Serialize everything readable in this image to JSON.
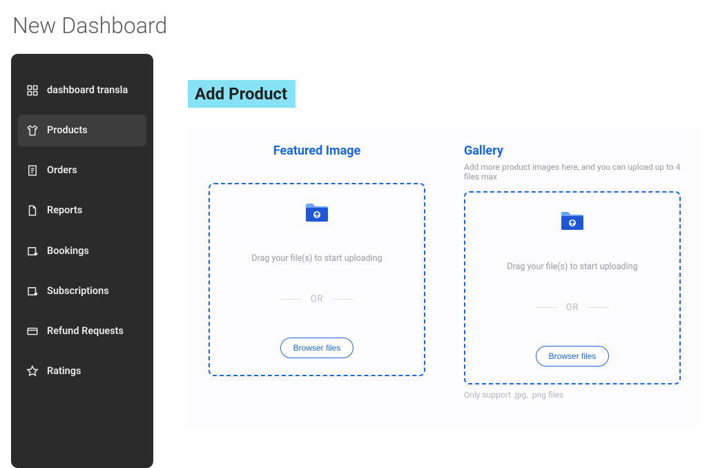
{
  "page_title": "New Dashboard",
  "sidebar": {
    "items": [
      {
        "label": "dashboard transla",
        "icon": "dashboard-icon"
      },
      {
        "label": "Products",
        "icon": "shirt-icon",
        "active": true
      },
      {
        "label": "Orders",
        "icon": "receipt-icon"
      },
      {
        "label": "Reports",
        "icon": "document-icon"
      },
      {
        "label": "Bookings",
        "icon": "calendar-export-icon"
      },
      {
        "label": "Subscriptions",
        "icon": "calendar-export-icon"
      },
      {
        "label": "Refund Requests",
        "icon": "card-icon"
      },
      {
        "label": "Ratings",
        "icon": "star-icon"
      }
    ]
  },
  "main": {
    "heading": "Add Product",
    "featured": {
      "title": "Featured Image",
      "drag_text": "Drag your file(s) to start uploading",
      "or_label": "OR",
      "browse_label": "Browser files"
    },
    "gallery": {
      "title": "Gallery",
      "subtitle": "Add more product images here, and you can upload up to 4 files max",
      "drag_text": "Drag your file(s) to start uploading",
      "or_label": "OR",
      "browse_label": "Browser files",
      "support_text": "Only support .jpg, .png files"
    }
  }
}
